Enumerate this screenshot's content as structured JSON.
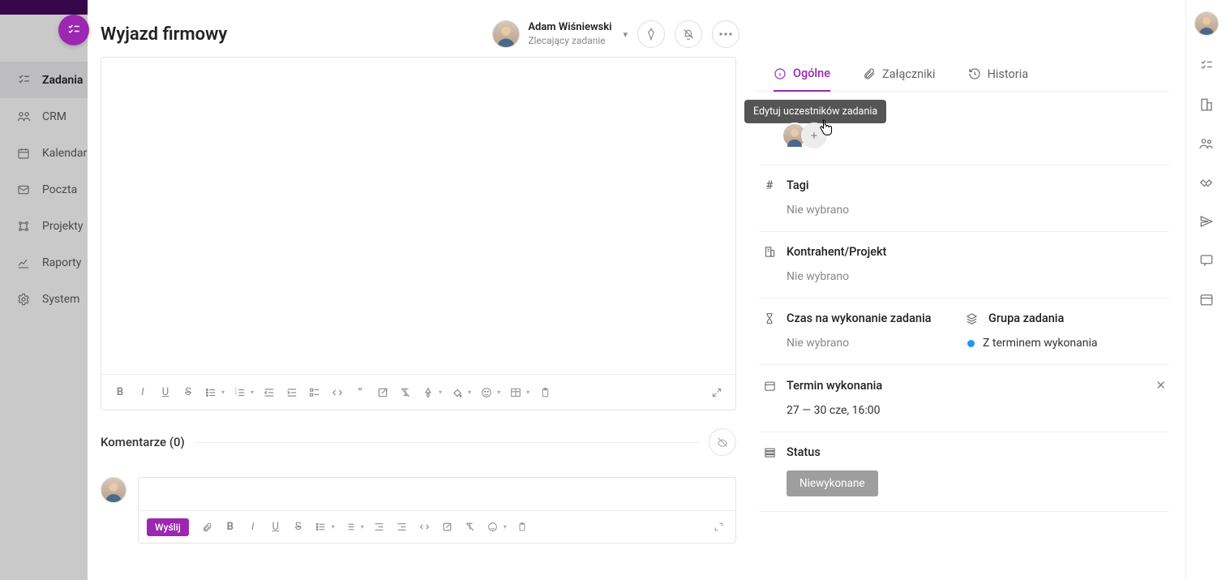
{
  "sidebar": {
    "items": [
      {
        "label": "Zadania",
        "icon": "tasks"
      },
      {
        "label": "CRM",
        "icon": "crm"
      },
      {
        "label": "Kalendarz",
        "icon": "calendar"
      },
      {
        "label": "Poczta",
        "icon": "mail"
      },
      {
        "label": "Projekty",
        "icon": "projects"
      },
      {
        "label": "Raporty",
        "icon": "reports"
      },
      {
        "label": "System",
        "icon": "gear"
      }
    ]
  },
  "task": {
    "title": "Wyjazd firmowy",
    "assignee_name": "Adam Wiśniewski",
    "assignee_role": "Zlecający zadanie"
  },
  "tabs": {
    "general": "Ogólne",
    "attachments": "Załączniki",
    "history": "Historia"
  },
  "tooltip": {
    "edit_participants": "Edytuj uczestników zadania"
  },
  "fields": {
    "tags_label": "Tagi",
    "tags_value": "Nie wybrano",
    "client_label": "Kontrahent/Projekt",
    "client_value": "Nie wybrano",
    "time_label": "Czas na wykonanie zadania",
    "time_value": "Nie wybrano",
    "group_label": "Grupa zadania",
    "group_value": "Z terminem wykonania",
    "deadline_label": "Termin wykonania",
    "deadline_value": "27 — 30 cze, 16:00",
    "status_label": "Status",
    "status_value": "Niewykonane"
  },
  "comments": {
    "title": "Komentarze (0)",
    "send": "Wyślij"
  }
}
